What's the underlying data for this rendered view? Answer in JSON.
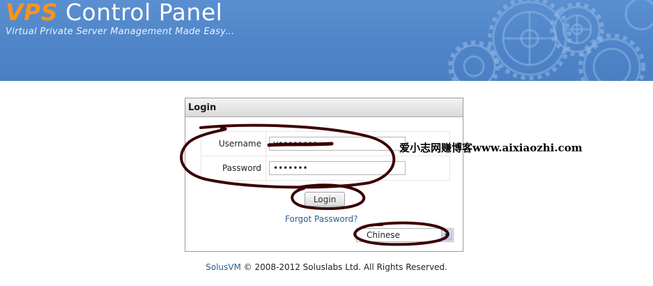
{
  "header": {
    "brand_prefix": "VPS",
    "brand_rest": " Control Panel",
    "tagline": "Virtual Private Server Management Made Easy...",
    "icon": "gears-icon",
    "bg_color": "#4f85c8",
    "accent_color": "#f7941d"
  },
  "login": {
    "title": "Login",
    "username_label": "Username",
    "username_value": "v••••••••",
    "password_label": "Password",
    "password_value": "•••••••",
    "button_label": "Login",
    "forgot_label": "Forgot Password?",
    "language_value": "Chinese",
    "language_icon": "chevron-down-icon"
  },
  "footer": {
    "product_link": "SolusVM",
    "copyright": " © 2008-2012 Soluslabs Ltd. All Rights Reserved."
  },
  "watermark": "爱小志网赚博客www.aixiaozhi.com",
  "annotation_color": "#3a0000"
}
